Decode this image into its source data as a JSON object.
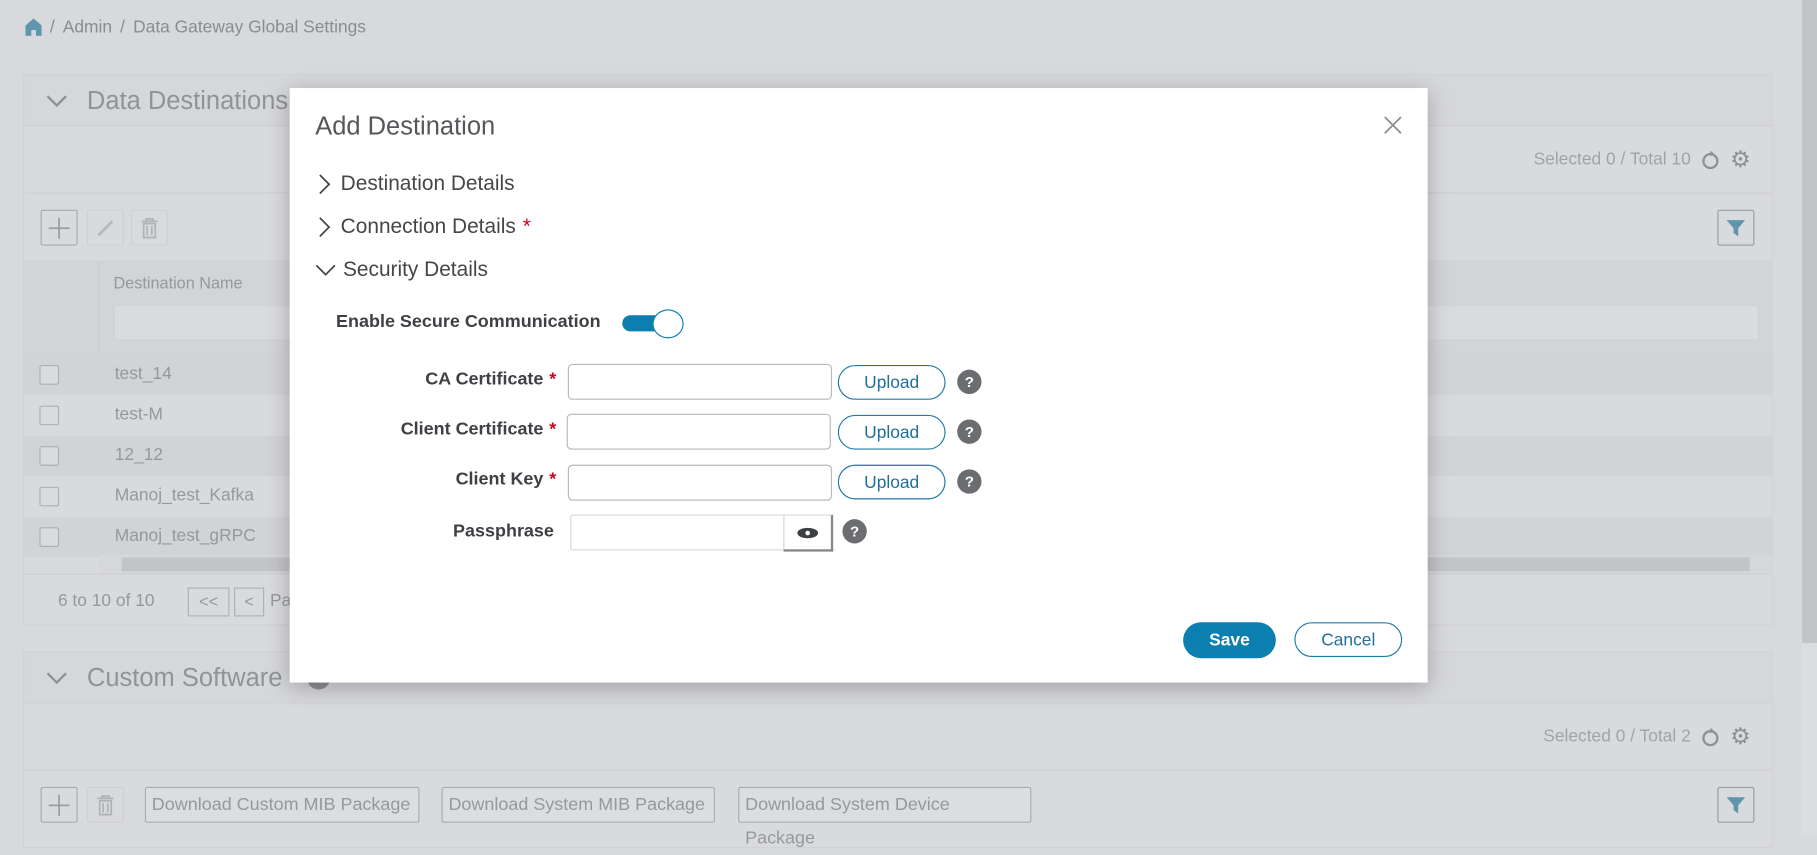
{
  "breadcrumb": {
    "sep": "/",
    "items": [
      "Admin",
      "Data Gateway Global Settings"
    ]
  },
  "data_destinations": {
    "title": "Data Destinations",
    "selection": "Selected 0 / Total 10",
    "column": "Destination Name",
    "rows": [
      "test_14",
      "test-M",
      "12_12",
      "Manoj_test_Kafka",
      "Manoj_test_gRPC"
    ],
    "pager": {
      "range": "6 to 10 of 10",
      "first": "<<",
      "prev": "<",
      "page": "Pa"
    }
  },
  "custom_software": {
    "title": "Custom Software",
    "selection": "Selected 0 / Total 2",
    "buttons": [
      "Download Custom MIB Package",
      "Download System MIB Package",
      "Download System Device Package"
    ]
  },
  "modal": {
    "title": "Add Destination",
    "sections": [
      "Destination Details",
      "Connection Details",
      "Security Details"
    ],
    "required_mark": "*",
    "toggle_label": "Enable Secure Communication",
    "toggle_on": true,
    "fields": [
      {
        "label": "CA Certificate",
        "value": "",
        "upload": "Upload"
      },
      {
        "label": "Client Certificate",
        "value": "",
        "upload": "Upload"
      },
      {
        "label": "Client Key",
        "value": "",
        "upload": "Upload"
      }
    ],
    "passphrase": {
      "label": "Passphrase",
      "value": ""
    },
    "help": "?",
    "save": "Save",
    "cancel": "Cancel"
  },
  "colors": {
    "accent": "#0a7fb0",
    "required": "#d0021b"
  }
}
